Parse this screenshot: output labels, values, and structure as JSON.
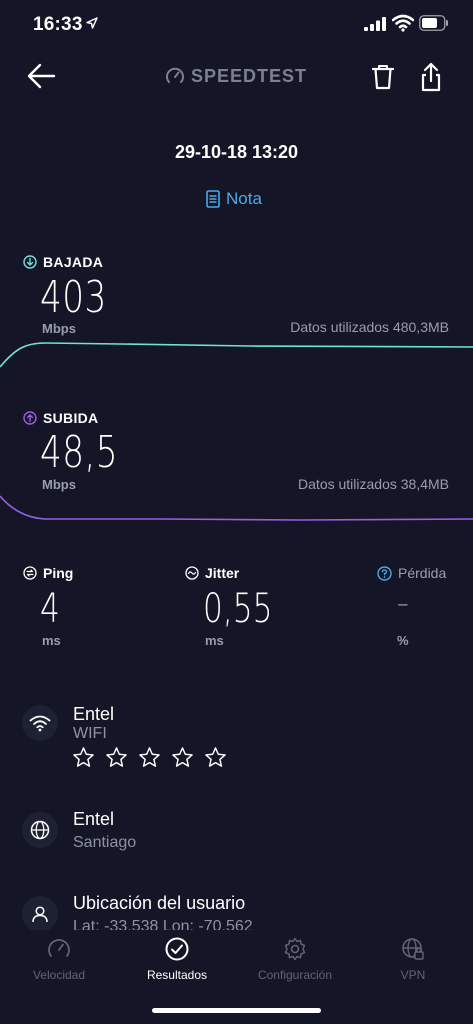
{
  "status": {
    "time": "16:33"
  },
  "header": {
    "title": "SPEEDTEST"
  },
  "result": {
    "date": "29-10-18 13:20",
    "note_label": "Nota"
  },
  "download": {
    "label": "BAJADA",
    "value": "403",
    "unit": "Mbps",
    "data_used": "Datos utilizados 480,3MB",
    "color": "#6fe3d6"
  },
  "upload": {
    "label": "SUBIDA",
    "value": "48,5",
    "unit": "Mbps",
    "data_used": "Datos utilizados 38,4MB",
    "color": "#9b5de5"
  },
  "metrics": {
    "ping": {
      "label": "Ping",
      "value": "4",
      "unit": "ms"
    },
    "jitter": {
      "label": "Jitter",
      "value": "0,55",
      "unit": "ms"
    },
    "loss": {
      "label": "Pérdida",
      "value": "–",
      "unit": "%"
    }
  },
  "network": {
    "provider": "Entel",
    "type": "WIFI",
    "rating_stars": 0,
    "rating_max": 5
  },
  "server": {
    "name": "Entel",
    "city": "Santiago"
  },
  "user_location": {
    "title": "Ubicación del usuario",
    "coords": "Lat: -33,538  Lon: -70,562"
  },
  "tabs": [
    {
      "label": "Velocidad",
      "icon": "gauge-icon"
    },
    {
      "label": "Resultados",
      "icon": "check-circle-icon",
      "active": true
    },
    {
      "label": "Configuración",
      "icon": "gear-icon"
    },
    {
      "label": "VPN",
      "icon": "vpn-globe-icon"
    }
  ],
  "colors": {
    "background": "#141526",
    "accent_blue": "#4ea8e8",
    "muted_text": "#9a9cb0"
  }
}
